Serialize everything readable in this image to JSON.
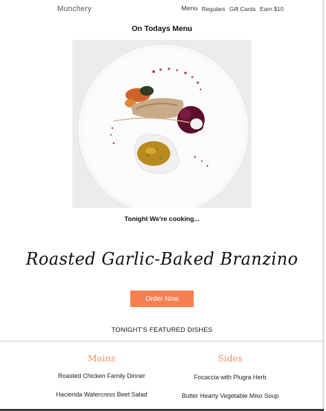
{
  "nav": {
    "brand": "Munchery",
    "links": [
      "Menu",
      "Regulars",
      "Gift Cards",
      "Earn $10"
    ]
  },
  "hero": {
    "heading": "On Todays Menu",
    "subheading": "Tonight We're cooking...",
    "dish_name": "Roasted Garlic-Baked Branzino",
    "order_label": "Order Now"
  },
  "featured": {
    "title": "TONIGHT'S FEATURED DISHES",
    "mains": {
      "title": "Mains",
      "items": [
        "Roasted Chicken Family Dinner",
        "Hacienda Watercress Beet Salad"
      ]
    },
    "sides": {
      "title": "Sides",
      "items": [
        "Focaccia with Plugra Herb",
        "Butter Hearty Vegetable Miso Soup"
      ]
    }
  },
  "colors": {
    "accent": "#f57f52",
    "section_title": "#f48f63"
  }
}
